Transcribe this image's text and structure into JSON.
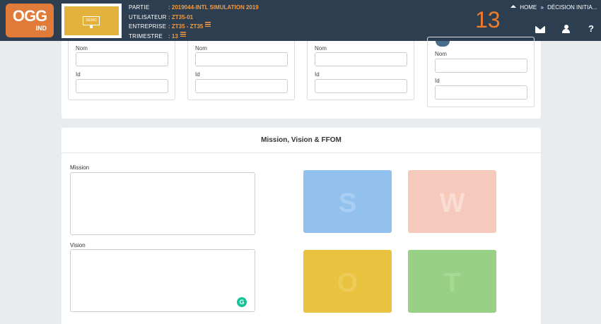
{
  "header": {
    "logo_top": "OGG",
    "logo_bottom": "IND",
    "demo_label": "DEMO",
    "info": [
      {
        "key": "PARTIE",
        "value": ": 2019044-INTL SIMULATION 2019"
      },
      {
        "key": "UTILISATEUR",
        "value": ": ZT35-01"
      },
      {
        "key": "ENTREPRISE",
        "value": ": ZT35 - ZT35"
      },
      {
        "key": "TRIMESTRE",
        "value": ": 13"
      }
    ],
    "quarter_number": "13",
    "breadcrumb": {
      "home": "HOME",
      "separator": "»",
      "current": "DÉCISION INITIA..."
    },
    "icons": {
      "mail": "envelope-icon",
      "user": "user-icon",
      "help": "?"
    }
  },
  "team_cards": [
    {
      "name_label": "Nom",
      "id_label": "Id",
      "name_value": "",
      "id_value": ""
    },
    {
      "name_label": "Nom",
      "id_label": "Id",
      "name_value": "",
      "id_value": ""
    },
    {
      "name_label": "Nom",
      "id_label": "Id",
      "name_value": "",
      "id_value": ""
    },
    {
      "name_label": "Nom",
      "id_label": "Id",
      "name_value": "",
      "id_value": ""
    }
  ],
  "mission_panel": {
    "title": "Mission, Vision & FFOM",
    "mission_label": "Mission",
    "mission_value": "",
    "vision_label": "Vision",
    "vision_value": "",
    "grammarly_glyph": "G",
    "swot": [
      {
        "letter": "S",
        "bg": "#93c1ee",
        "fg": "#a9cef2"
      },
      {
        "letter": "W",
        "bg": "#f5c9bb",
        "fg": "#f9dcd2"
      },
      {
        "letter": "O",
        "bg": "#e9c23f",
        "fg": "#eccb57"
      },
      {
        "letter": "T",
        "bg": "#98d085",
        "fg": "#a9d999"
      }
    ]
  }
}
